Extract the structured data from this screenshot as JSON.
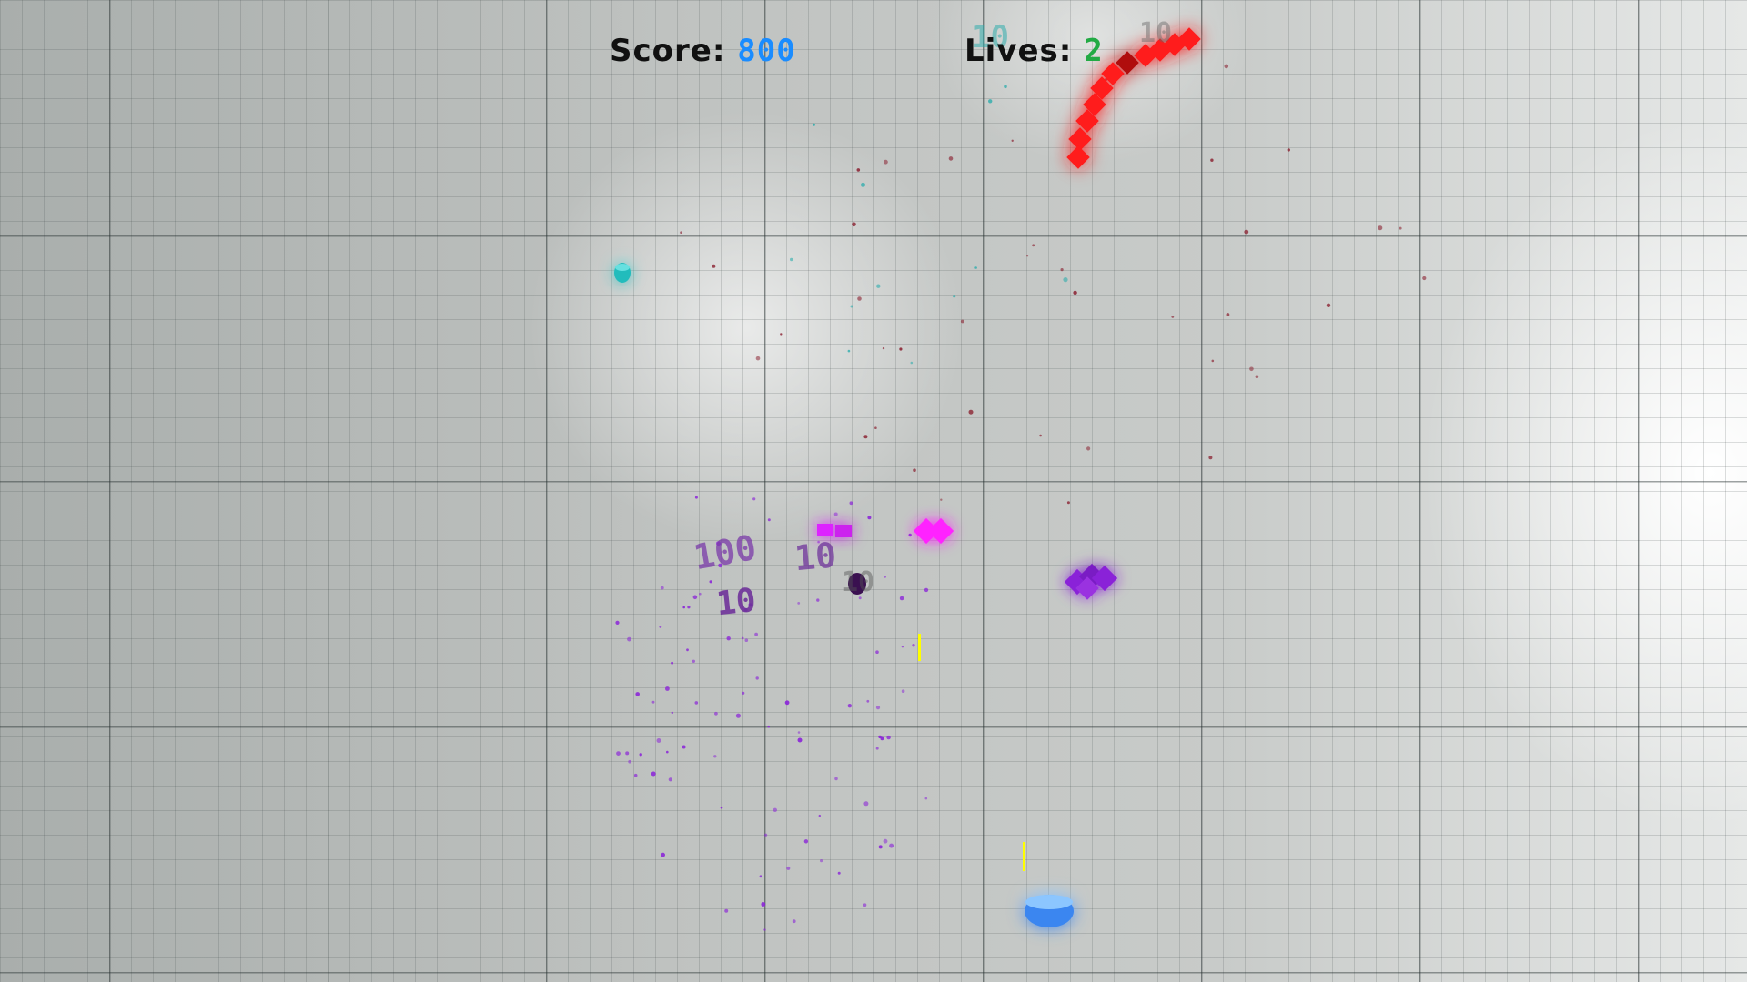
{
  "hud": {
    "score_label": "Score:",
    "score_value": "800",
    "lives_label": "Lives:",
    "lives_value": "2"
  },
  "floating_points": [
    "100",
    "10",
    "10",
    "10",
    "10",
    "10"
  ],
  "colors": {
    "score": "#1a8cff",
    "lives": "#22aa44",
    "snake": "#ff1a1a",
    "magenta": "#ff22ff",
    "purple": "#8a22d8",
    "player": "#4aa0ff",
    "cyan_pickup": "#22bcbc",
    "bullet": "#ffff00"
  },
  "icons": {
    "player": "player-ship-icon",
    "enemy_snake": "snake-enemy-icon",
    "enemy_diamond": "diamond-enemy-icon",
    "pickup": "cyan-pickup-icon"
  }
}
